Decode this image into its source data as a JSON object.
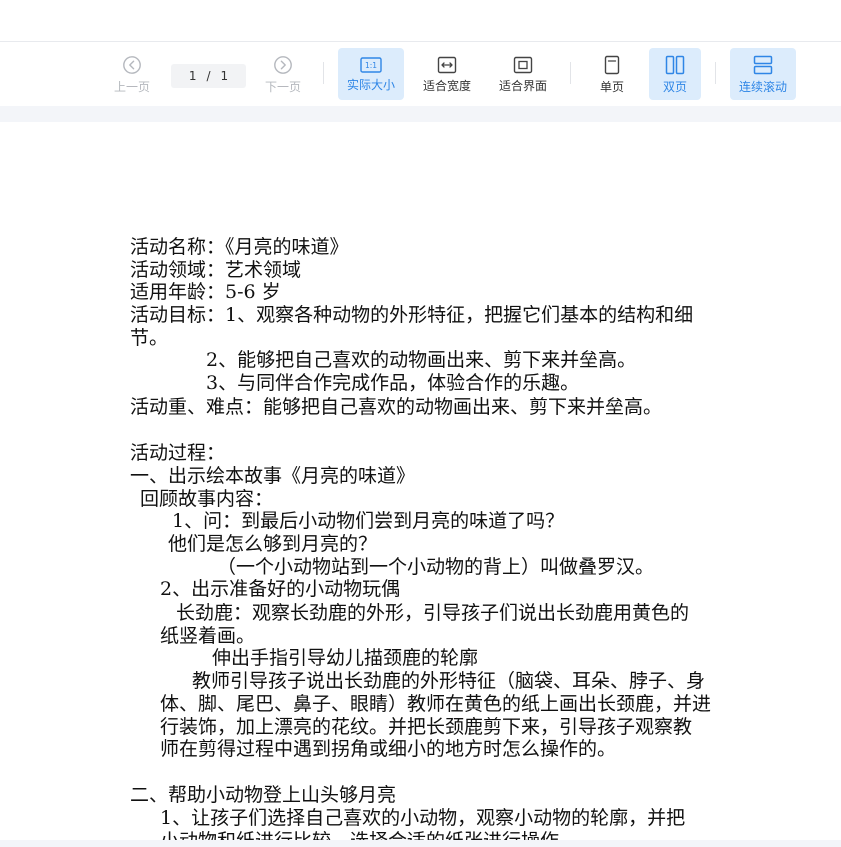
{
  "toolbar": {
    "prev_label": "上一页",
    "next_label": "下一页",
    "page_current": "1",
    "page_separator": "/",
    "page_total": "1",
    "actual_size_label": "实际大小",
    "actual_size_icon_text": "1:1",
    "fit_width_label": "适合宽度",
    "fit_page_label": "适合界面",
    "single_page_label": "单页",
    "double_page_label": "双页",
    "continuous_label": "连续滚动"
  },
  "colors": {
    "accent": "#2f86e6",
    "active_bg": "#dcecfc",
    "disabled": "#b5b8be"
  },
  "document": {
    "lines": [
      "活动名称：《月亮的味道》",
      "活动领域：艺术领域",
      "适用年龄：5-6 岁",
      "活动目标：1、观察各种动物的外形特征，把握它们基本的结构和细",
      "节。",
      "2、能够把自己喜欢的动物画出来、剪下来并垒高。",
      "3、与同伴合作完成作品，体验合作的乐趣。",
      "活动重、难点：能够把自己喜欢的动物画出来、剪下来并垒高。",
      "活动过程：",
      "一、出示绘本故事《月亮的味道》",
      "回顾故事内容：",
      "1、问：到最后小动物们尝到月亮的味道了吗？",
      "他们是怎么够到月亮的？",
      "（一个小动物站到一个小动物的背上）叫做叠罗汉。",
      "2、出示准备好的小动物玩偶",
      "长劲鹿：观察长劲鹿的外形，引导孩子们说出长劲鹿用黄色的",
      "纸竖着画。",
      "伸出手指引导幼儿描颈鹿的轮廓",
      "教师引导孩子说出长劲鹿的外形特征（脑袋、耳朵、脖子、身",
      "体、脚、尾巴、鼻子、眼睛）教师在黄色的纸上画出长颈鹿，并进",
      "行装饰，加上漂亮的花纹。并把长颈鹿剪下来，引导孩子观察教",
      "师在剪得过程中遇到拐角或细小的地方时怎么操作的。",
      "二、帮助小动物登上山头够月亮",
      "1、让孩子们选择自己喜欢的小动物，观察小动物的轮廓，并把",
      "小动物和纸进行比较，选择合适的纸张进行操作。"
    ]
  }
}
